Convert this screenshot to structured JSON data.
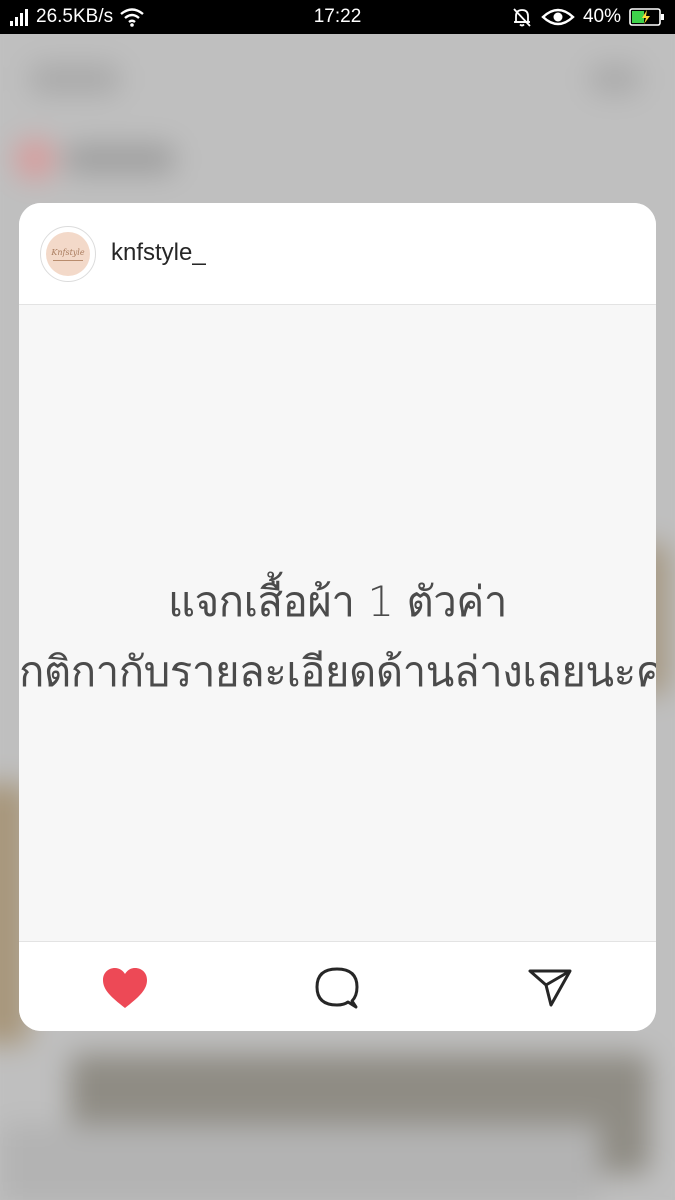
{
  "status_bar": {
    "network_speed": "26.5KB/s",
    "time": "17:22",
    "battery_percent": "40%",
    "icons": [
      "signal-icon",
      "wifi-icon",
      "mute-bell-icon",
      "eye-icon",
      "battery-charging-icon"
    ]
  },
  "post_preview": {
    "username": "knfstyle_",
    "avatar_logo_text": "Knfstyle",
    "caption_lines": [
      "แจกเสื้อผ้า 1 ตัวค่า",
      "กติกากับรายละเอียดด้านล่างเลยนะคะ"
    ],
    "actions": {
      "like_icon": "heart-filled-icon",
      "comment_icon": "comment-bubble-icon",
      "share_icon": "send-paper-plane-icon"
    }
  },
  "colors": {
    "like": "#ed4956",
    "status_bar_bg": "#000000",
    "battery_fill": "#3fd24b",
    "card_bg": "#ffffff",
    "media_bg": "#f7f7f7"
  }
}
